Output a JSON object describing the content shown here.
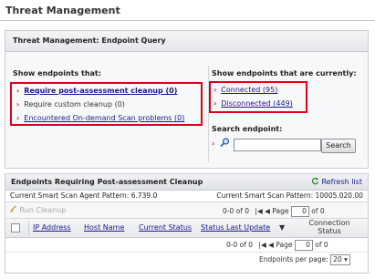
{
  "page": {
    "title": "Threat Management"
  },
  "query_panel": {
    "title": "Threat Management: Endpoint Query",
    "show_that_label": "Show endpoints that:",
    "show_that_items": [
      {
        "label": "Require post-assessment cleanup (0)",
        "link": true,
        "bold": true
      },
      {
        "label": "Require custom cleanup (0)",
        "link": false,
        "bold": false
      },
      {
        "label": "Encountered On-demand Scan problems (0)",
        "link": true,
        "bold": false
      }
    ],
    "currently_label": "Show endpoints that are currently:",
    "currently_items": [
      {
        "label": "Connected (95)"
      },
      {
        "label": "Disconnected (449)"
      }
    ],
    "search_label": "Search endpoint:",
    "search_value": "",
    "search_button": "Search"
  },
  "table_panel": {
    "title": "Endpoints Requiring Post-assessment Cleanup",
    "refresh_label": "Refresh list",
    "agent_pattern_label": "Current Smart Scan Agent Pattern: 6.739.0",
    "scan_pattern_label": "Current Smart Scan Pattern: 10005.020.00",
    "run_cleanup_label": "Run Cleanup",
    "pager_count": "0-0 of 0",
    "pager_page_label": "Page",
    "pager_page_value": "0",
    "pager_of": "of 0",
    "columns": [
      "IP Address",
      "Host Name",
      "Current Status",
      "Status Last Update",
      "Connection Status"
    ],
    "per_page_label": "Endpoints per page:",
    "per_page_value": "20"
  },
  "colors": {
    "highlight": "#e0001a",
    "link": "#1a1a8c",
    "bullet": "#c8102e"
  }
}
